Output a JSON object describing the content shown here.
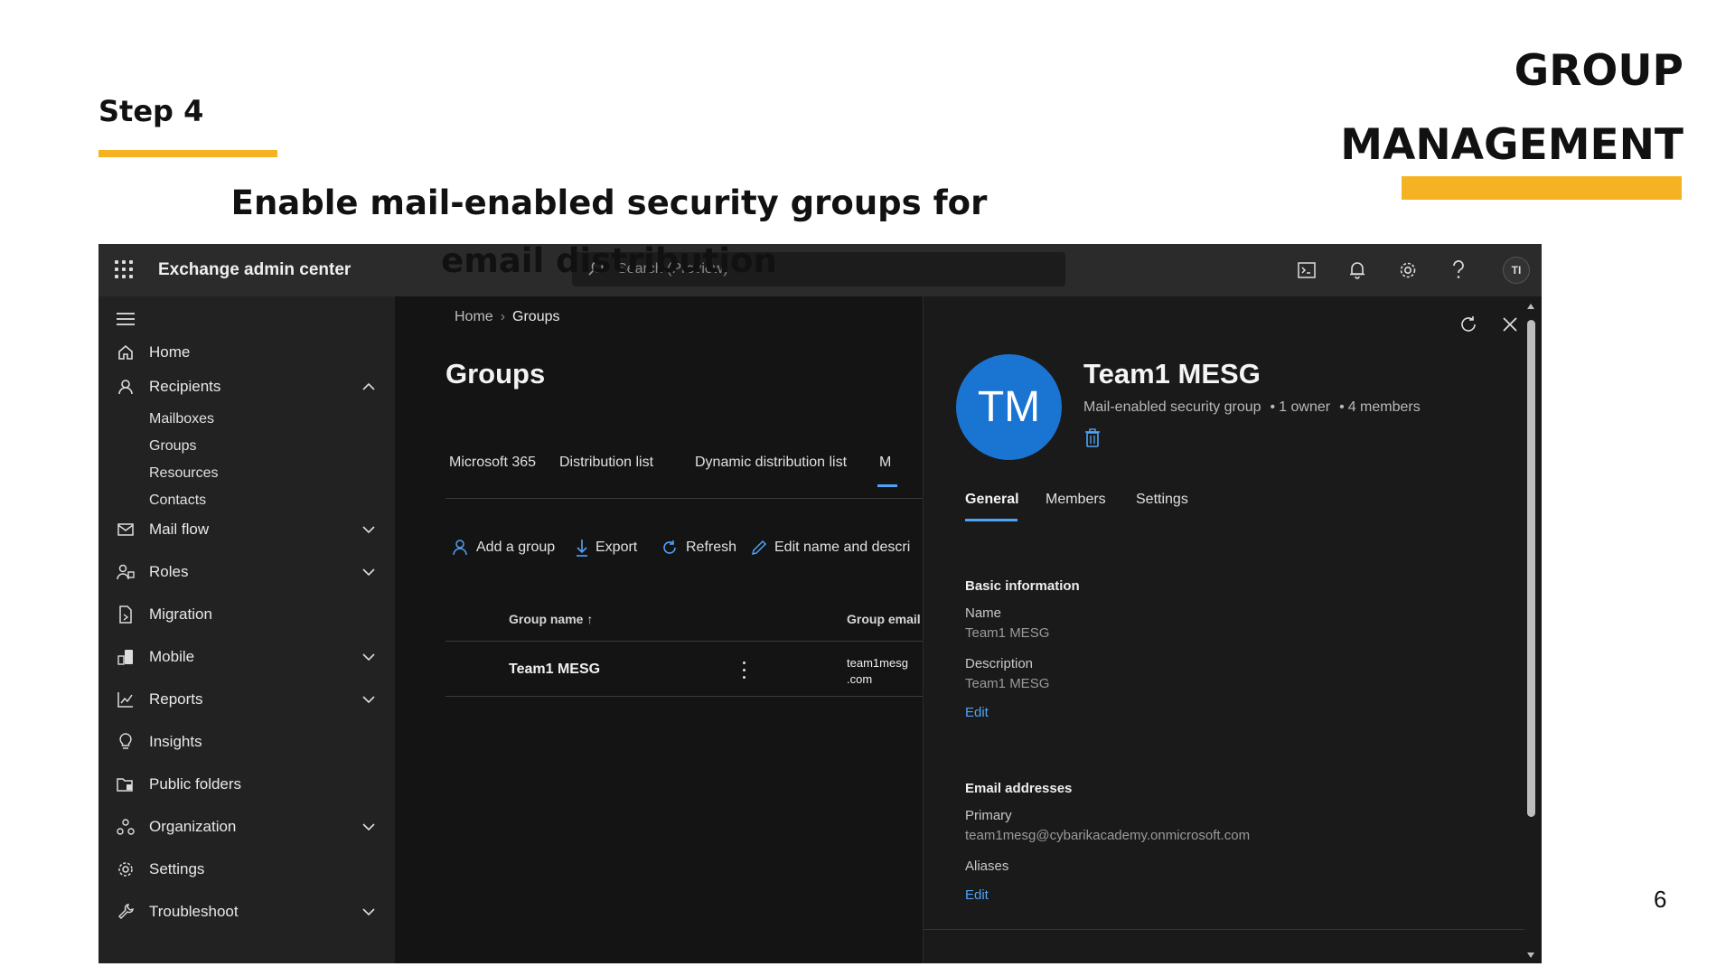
{
  "slide": {
    "step": "Step 4",
    "title_line1": "GROUP",
    "title_line2": "MANAGEMENT",
    "subtitle": "Enable mail-enabled security groups for email distribution",
    "page_number": "6",
    "accent_color": "#f5b323"
  },
  "app": {
    "name": "Exchange admin center",
    "search_placeholder": "Search (Preview)",
    "user_initials": "TI",
    "top_icons": [
      "terminal-icon",
      "bell-icon",
      "gear-icon",
      "help-icon"
    ]
  },
  "sidebar": {
    "items": [
      {
        "label": "Home",
        "icon": "home-icon",
        "chevron": ""
      },
      {
        "label": "Recipients",
        "icon": "person-icon",
        "chevron": "up"
      },
      {
        "label": "Mail flow",
        "icon": "mail-icon",
        "chevron": "down"
      },
      {
        "label": "Roles",
        "icon": "roles-icon",
        "chevron": "down"
      },
      {
        "label": "Migration",
        "icon": "migration-icon",
        "chevron": ""
      },
      {
        "label": "Mobile",
        "icon": "mobile-icon",
        "chevron": "down"
      },
      {
        "label": "Reports",
        "icon": "chart-icon",
        "chevron": "down"
      },
      {
        "label": "Insights",
        "icon": "lightbulb-icon",
        "chevron": ""
      },
      {
        "label": "Public folders",
        "icon": "folder-icon",
        "chevron": ""
      },
      {
        "label": "Organization",
        "icon": "org-icon",
        "chevron": "down"
      },
      {
        "label": "Settings",
        "icon": "gear-icon",
        "chevron": ""
      },
      {
        "label": "Troubleshoot",
        "icon": "wrench-icon",
        "chevron": "down"
      }
    ],
    "recipients_sub": [
      "Mailboxes",
      "Groups",
      "Resources",
      "Contacts"
    ]
  },
  "main": {
    "breadcrumb": [
      "Home",
      "Groups"
    ],
    "heading": "Groups",
    "tabs": [
      "Microsoft 365",
      "Distribution list",
      "Dynamic distribution list",
      "M"
    ],
    "commands": [
      "Add a group",
      "Export",
      "Refresh",
      "Edit name and descri"
    ],
    "columns": {
      "group_name": "Group name",
      "group_email": "Group email",
      "sort_indicator": "↑"
    },
    "rows": [
      {
        "group_name": "Team1 MESG",
        "email_line1": "team1mesg",
        "email_line2": ".com"
      }
    ]
  },
  "panel": {
    "initials": "TM",
    "avatar_color": "#1a74d2",
    "group_name": "Team1 MESG",
    "group_type": "Mail-enabled security group",
    "owners": "1 owner",
    "members": "4 members",
    "tabs": [
      "General",
      "Members",
      "Settings"
    ],
    "active_tab": "General",
    "basic_info": {
      "heading": "Basic information",
      "name_label": "Name",
      "name_value": "Team1 MESG",
      "desc_label": "Description",
      "desc_value": "Team1 MESG",
      "edit": "Edit"
    },
    "email": {
      "heading": "Email addresses",
      "primary_label": "Primary",
      "primary_value": "team1mesg@cybarikacademy.onmicrosoft.com",
      "aliases_label": "Aliases",
      "edit": "Edit"
    }
  }
}
